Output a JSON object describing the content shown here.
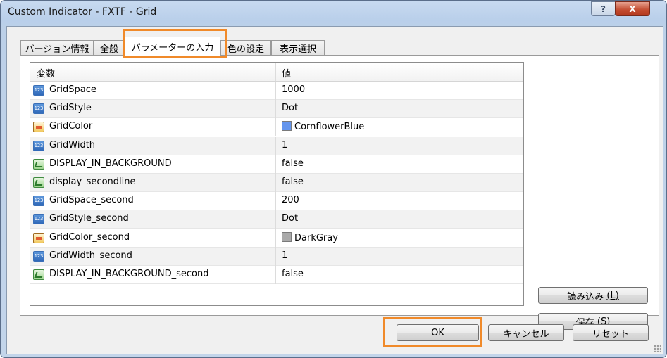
{
  "window": {
    "title": "Custom Indicator - FXTF - Grid",
    "help_label": "?",
    "close_label": "X"
  },
  "tabs": [
    {
      "label": "バージョン情報",
      "active": false
    },
    {
      "label": "全般",
      "active": false
    },
    {
      "label": "パラメーターの入力",
      "active": true
    },
    {
      "label": "色の設定",
      "active": false
    },
    {
      "label": "表示選択",
      "active": false
    }
  ],
  "grid": {
    "columns": [
      "変数",
      "値"
    ],
    "rows": [
      {
        "icon": "numeric-icon",
        "name": "GridSpace",
        "value": "1000"
      },
      {
        "icon": "numeric-icon",
        "name": "GridStyle",
        "value": "Dot"
      },
      {
        "icon": "color-icon",
        "name": "GridColor",
        "value": "CornflowerBlue",
        "swatch": "#6495ED"
      },
      {
        "icon": "numeric-icon",
        "name": "GridWidth",
        "value": "1"
      },
      {
        "icon": "boolean-icon",
        "name": "DISPLAY_IN_BACKGROUND",
        "value": "false"
      },
      {
        "icon": "boolean-icon",
        "name": "display_secondline",
        "value": "false"
      },
      {
        "icon": "numeric-icon",
        "name": "GridSpace_second",
        "value": "200"
      },
      {
        "icon": "numeric-icon",
        "name": "GridStyle_second",
        "value": "Dot"
      },
      {
        "icon": "color-icon",
        "name": "GridColor_second",
        "value": "DarkGray",
        "swatch": "#A9A9A9"
      },
      {
        "icon": "numeric-icon",
        "name": "GridWidth_second",
        "value": "1"
      },
      {
        "icon": "boolean-icon",
        "name": "DISPLAY_IN_BACKGROUND_second",
        "value": "false"
      }
    ]
  },
  "side_buttons": {
    "load_label": "読み込み",
    "load_key": "(L)",
    "save_label": "保存",
    "save_key": "(S)"
  },
  "footer": {
    "ok_label": "OK",
    "cancel_label": "キャンセル",
    "reset_label": "リセット"
  },
  "colors": {
    "highlight": "#f08a2a"
  }
}
